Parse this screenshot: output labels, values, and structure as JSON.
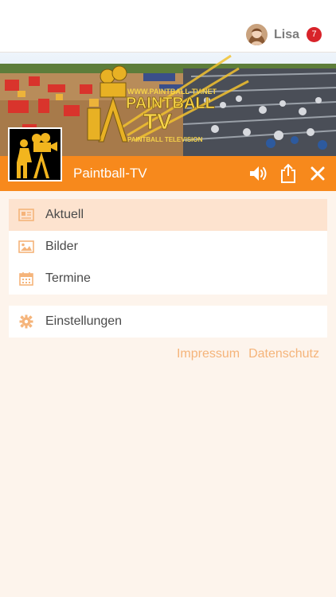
{
  "header": {
    "user_name": "Lisa",
    "notification_count": "7"
  },
  "channel": {
    "banner_text_line1": "WWW.PAINTBALL-TV.NET",
    "banner_text_line2": "PAINTBALL",
    "banner_text_line3": "TV",
    "banner_text_line4": "PAINTBALL TELEVISION",
    "title": "Paintball-TV"
  },
  "colors": {
    "accent": "#f7891c",
    "active_item_bg": "#fde3cf",
    "link": "#f5b47a",
    "badge": "#d8232a",
    "background": "#fdf4ec"
  },
  "menu": {
    "items": [
      {
        "label": "Aktuell",
        "icon": "newspaper-icon",
        "active": true
      },
      {
        "label": "Bilder",
        "icon": "image-icon",
        "active": false
      },
      {
        "label": "Termine",
        "icon": "calendar-icon",
        "active": false
      }
    ],
    "settings": {
      "label": "Einstellungen",
      "icon": "gear-icon"
    }
  },
  "footer_links": {
    "impressum": "Impressum",
    "datenschutz": "Datenschutz"
  }
}
